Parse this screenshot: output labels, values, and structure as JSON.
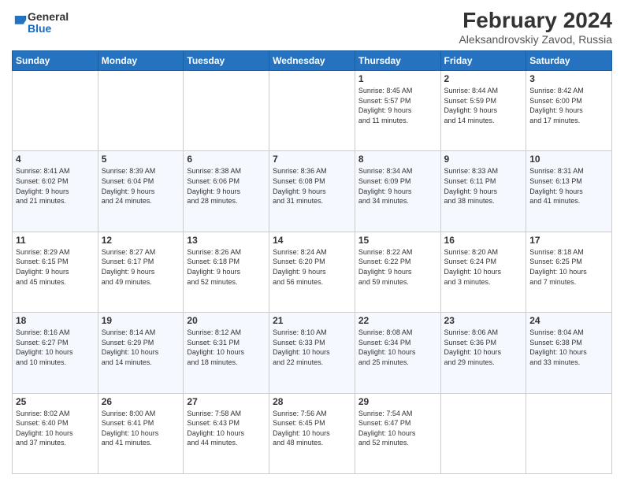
{
  "logo": {
    "general": "General",
    "blue": "Blue"
  },
  "header": {
    "title": "February 2024",
    "subtitle": "Aleksandrovskiy Zavod, Russia"
  },
  "days_of_week": [
    "Sunday",
    "Monday",
    "Tuesday",
    "Wednesday",
    "Thursday",
    "Friday",
    "Saturday"
  ],
  "weeks": [
    [
      {
        "day": "",
        "info": ""
      },
      {
        "day": "",
        "info": ""
      },
      {
        "day": "",
        "info": ""
      },
      {
        "day": "",
        "info": ""
      },
      {
        "day": "1",
        "info": "Sunrise: 8:45 AM\nSunset: 5:57 PM\nDaylight: 9 hours\nand 11 minutes."
      },
      {
        "day": "2",
        "info": "Sunrise: 8:44 AM\nSunset: 5:59 PM\nDaylight: 9 hours\nand 14 minutes."
      },
      {
        "day": "3",
        "info": "Sunrise: 8:42 AM\nSunset: 6:00 PM\nDaylight: 9 hours\nand 17 minutes."
      }
    ],
    [
      {
        "day": "4",
        "info": "Sunrise: 8:41 AM\nSunset: 6:02 PM\nDaylight: 9 hours\nand 21 minutes."
      },
      {
        "day": "5",
        "info": "Sunrise: 8:39 AM\nSunset: 6:04 PM\nDaylight: 9 hours\nand 24 minutes."
      },
      {
        "day": "6",
        "info": "Sunrise: 8:38 AM\nSunset: 6:06 PM\nDaylight: 9 hours\nand 28 minutes."
      },
      {
        "day": "7",
        "info": "Sunrise: 8:36 AM\nSunset: 6:08 PM\nDaylight: 9 hours\nand 31 minutes."
      },
      {
        "day": "8",
        "info": "Sunrise: 8:34 AM\nSunset: 6:09 PM\nDaylight: 9 hours\nand 34 minutes."
      },
      {
        "day": "9",
        "info": "Sunrise: 8:33 AM\nSunset: 6:11 PM\nDaylight: 9 hours\nand 38 minutes."
      },
      {
        "day": "10",
        "info": "Sunrise: 8:31 AM\nSunset: 6:13 PM\nDaylight: 9 hours\nand 41 minutes."
      }
    ],
    [
      {
        "day": "11",
        "info": "Sunrise: 8:29 AM\nSunset: 6:15 PM\nDaylight: 9 hours\nand 45 minutes."
      },
      {
        "day": "12",
        "info": "Sunrise: 8:27 AM\nSunset: 6:17 PM\nDaylight: 9 hours\nand 49 minutes."
      },
      {
        "day": "13",
        "info": "Sunrise: 8:26 AM\nSunset: 6:18 PM\nDaylight: 9 hours\nand 52 minutes."
      },
      {
        "day": "14",
        "info": "Sunrise: 8:24 AM\nSunset: 6:20 PM\nDaylight: 9 hours\nand 56 minutes."
      },
      {
        "day": "15",
        "info": "Sunrise: 8:22 AM\nSunset: 6:22 PM\nDaylight: 9 hours\nand 59 minutes."
      },
      {
        "day": "16",
        "info": "Sunrise: 8:20 AM\nSunset: 6:24 PM\nDaylight: 10 hours\nand 3 minutes."
      },
      {
        "day": "17",
        "info": "Sunrise: 8:18 AM\nSunset: 6:25 PM\nDaylight: 10 hours\nand 7 minutes."
      }
    ],
    [
      {
        "day": "18",
        "info": "Sunrise: 8:16 AM\nSunset: 6:27 PM\nDaylight: 10 hours\nand 10 minutes."
      },
      {
        "day": "19",
        "info": "Sunrise: 8:14 AM\nSunset: 6:29 PM\nDaylight: 10 hours\nand 14 minutes."
      },
      {
        "day": "20",
        "info": "Sunrise: 8:12 AM\nSunset: 6:31 PM\nDaylight: 10 hours\nand 18 minutes."
      },
      {
        "day": "21",
        "info": "Sunrise: 8:10 AM\nSunset: 6:33 PM\nDaylight: 10 hours\nand 22 minutes."
      },
      {
        "day": "22",
        "info": "Sunrise: 8:08 AM\nSunset: 6:34 PM\nDaylight: 10 hours\nand 25 minutes."
      },
      {
        "day": "23",
        "info": "Sunrise: 8:06 AM\nSunset: 6:36 PM\nDaylight: 10 hours\nand 29 minutes."
      },
      {
        "day": "24",
        "info": "Sunrise: 8:04 AM\nSunset: 6:38 PM\nDaylight: 10 hours\nand 33 minutes."
      }
    ],
    [
      {
        "day": "25",
        "info": "Sunrise: 8:02 AM\nSunset: 6:40 PM\nDaylight: 10 hours\nand 37 minutes."
      },
      {
        "day": "26",
        "info": "Sunrise: 8:00 AM\nSunset: 6:41 PM\nDaylight: 10 hours\nand 41 minutes."
      },
      {
        "day": "27",
        "info": "Sunrise: 7:58 AM\nSunset: 6:43 PM\nDaylight: 10 hours\nand 44 minutes."
      },
      {
        "day": "28",
        "info": "Sunrise: 7:56 AM\nSunset: 6:45 PM\nDaylight: 10 hours\nand 48 minutes."
      },
      {
        "day": "29",
        "info": "Sunrise: 7:54 AM\nSunset: 6:47 PM\nDaylight: 10 hours\nand 52 minutes."
      },
      {
        "day": "",
        "info": ""
      },
      {
        "day": "",
        "info": ""
      }
    ]
  ]
}
